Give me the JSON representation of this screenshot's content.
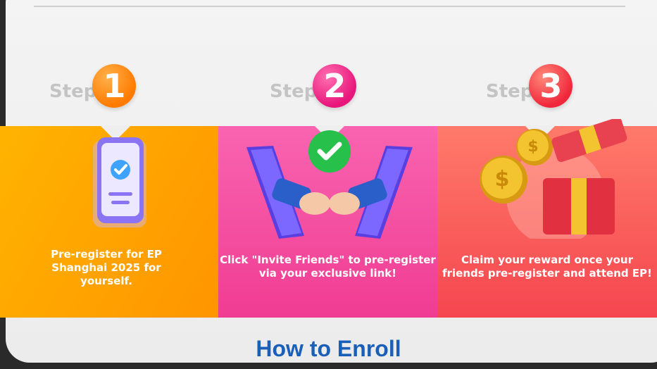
{
  "steps": [
    {
      "word": "Step",
      "number": "1",
      "caption": "Pre-register for EP Shanghai 2025 for yourself.",
      "icon": "phone-check-icon"
    },
    {
      "word": "Step",
      "number": "2",
      "caption": "Click \"Invite Friends\" to pre-register via your exclusive link!",
      "icon": "fist-bump-icon"
    },
    {
      "word": "Step",
      "number": "3",
      "caption": "Claim your reward once your friends pre-register and attend EP!",
      "icon": "coins-gift-icon"
    }
  ],
  "footer": {
    "title": "How to Enroll"
  },
  "colors": {
    "step1": "#ff9500",
    "step2": "#f03c92",
    "step3": "#f5464f",
    "title": "#1a5fb8"
  }
}
